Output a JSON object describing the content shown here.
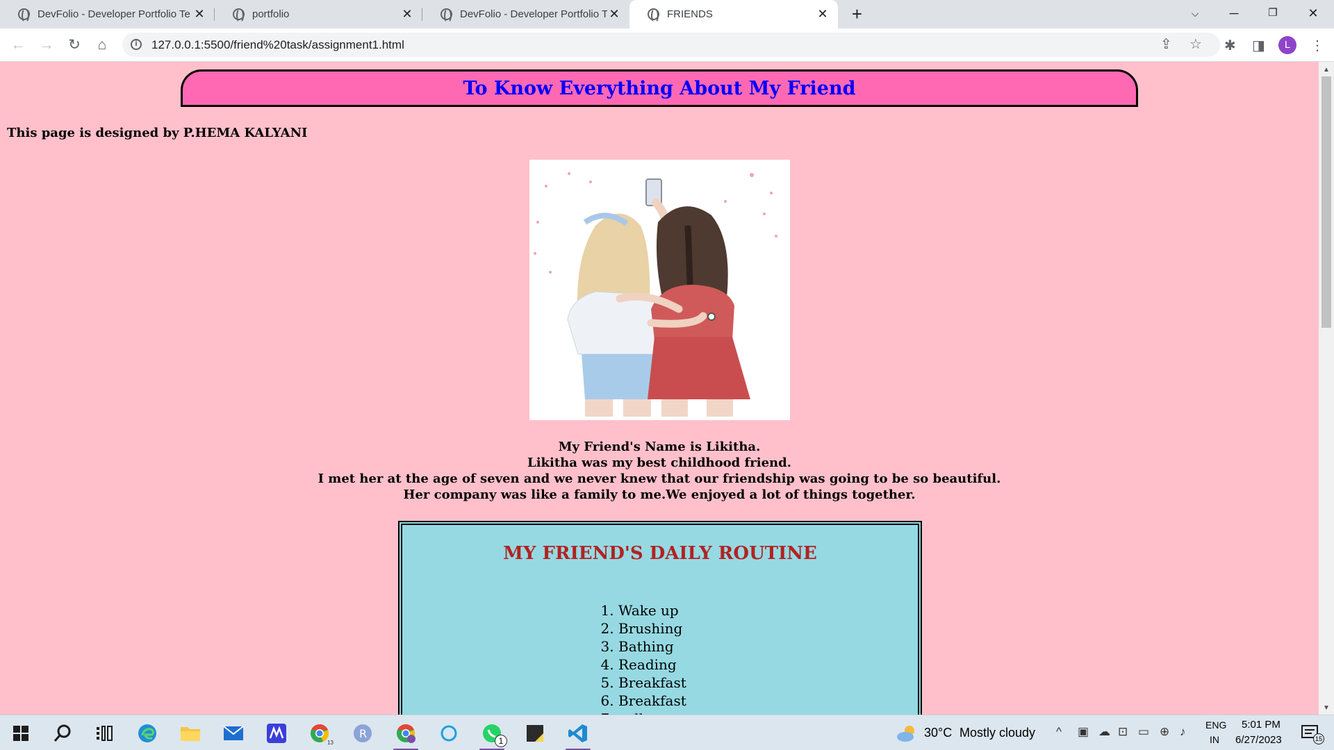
{
  "browser": {
    "tabs": [
      {
        "title": "DevFolio - Developer Portfolio Te",
        "active": false
      },
      {
        "title": "portfolio",
        "active": false
      },
      {
        "title": "DevFolio - Developer Portfolio Te",
        "active": false
      },
      {
        "title": "FRIENDS",
        "active": true
      }
    ],
    "new_tab": "+",
    "address": "127.0.0.1:5500/friend%20task/assignment1.html",
    "profile_initial": "L"
  },
  "page": {
    "banner_title": "To Know Everything About My Friend",
    "designer_note": "This page is designed by P.HEMA KALYANI",
    "intro_lines": [
      "My Friend's Name is Likitha.",
      "Likitha was my best childhood friend.",
      "I met her at the age of seven and we never knew that our friendship was going to be so beautiful.",
      "Her company was like a family to me.We enjoyed a lot of things together."
    ],
    "routine_title": "MY FRIEND'S DAILY ROUTINE",
    "routine_items": [
      "Wake up",
      "Brushing",
      "Bathing",
      "Reading",
      "Breakfast",
      "Breakfast",
      "college"
    ]
  },
  "taskbar": {
    "weather_temp": "30°C",
    "weather_desc": "Mostly cloudy",
    "lang": "ENG",
    "region": "IN",
    "time": "5:01 PM",
    "date": "6/27/2023",
    "whatsapp_badge": "1",
    "chrome_badge": "13",
    "notification_count": "15"
  },
  "colors": {
    "page_bg": "#ffc0cb",
    "banner_bg": "#ff69b4",
    "banner_text": "#0000ff",
    "routine_bg": "#96d9e2",
    "routine_title": "#b22222"
  }
}
